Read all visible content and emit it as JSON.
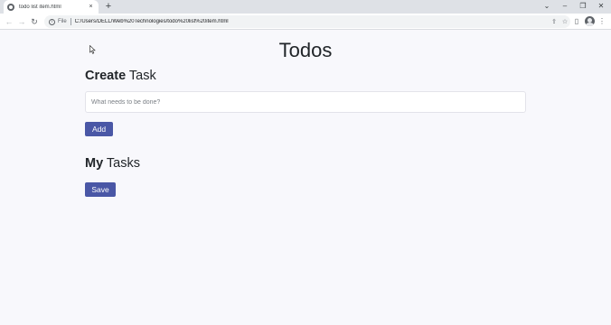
{
  "browser": {
    "tab": {
      "title": "todo list item.html",
      "close": "×"
    },
    "new_tab": "+",
    "window_controls": {
      "tab_search": "⌄",
      "minimize": "–",
      "restore": "❐",
      "close": "✕"
    },
    "nav": {
      "back": "←",
      "forward": "→",
      "reload": "↻"
    },
    "address": {
      "info": "i",
      "scheme": "File",
      "url": "C:/Users/DELL/Web%20Technologies/todo%20list%20item.html"
    },
    "toolbar_icons": {
      "share": "⇪",
      "bookmark": "☆",
      "side_panel": "▯",
      "menu": "⋮"
    }
  },
  "page": {
    "title": "Todos",
    "create_section": {
      "bold": "Create",
      "rest": " Task"
    },
    "task_input": {
      "placeholder": "What needs to be done?",
      "value": ""
    },
    "add_button": "Add",
    "tasks_section": {
      "bold": "My",
      "rest": " Tasks"
    },
    "save_button": "Save"
  },
  "colors": {
    "accent": "#4a57a6",
    "page_bg": "#f8f8fc",
    "text": "#212529"
  }
}
